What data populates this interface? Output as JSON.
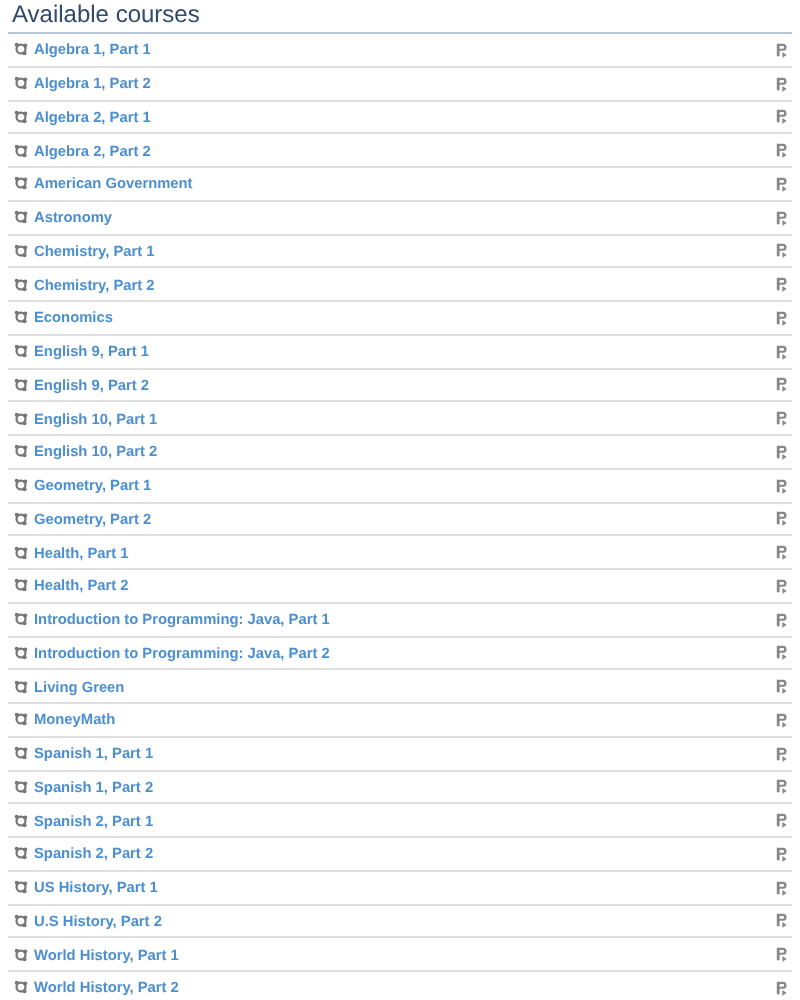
{
  "title": "Available courses",
  "courses": [
    {
      "name": "Algebra 1, Part 1"
    },
    {
      "name": "Algebra 1, Part 2"
    },
    {
      "name": "Algebra 2, Part 1"
    },
    {
      "name": "Algebra 2, Part 2"
    },
    {
      "name": "American Government"
    },
    {
      "name": "Astronomy"
    },
    {
      "name": "Chemistry, Part 1"
    },
    {
      "name": "Chemistry, Part 2"
    },
    {
      "name": "Economics"
    },
    {
      "name": "English 9, Part 1"
    },
    {
      "name": "English 9, Part 2"
    },
    {
      "name": "English 10, Part 1"
    },
    {
      "name": "English 10, Part 2"
    },
    {
      "name": "Geometry, Part 1"
    },
    {
      "name": "Geometry, Part 2"
    },
    {
      "name": "Health, Part 1"
    },
    {
      "name": "Health, Part 2"
    },
    {
      "name": "Introduction to Programming: Java, Part 1"
    },
    {
      "name": "Introduction to Programming: Java, Part 2"
    },
    {
      "name": "Living Green"
    },
    {
      "name": "MoneyMath"
    },
    {
      "name": "Spanish 1, Part 1"
    },
    {
      "name": "Spanish 1, Part 2"
    },
    {
      "name": "Spanish 2, Part 1"
    },
    {
      "name": "Spanish 2, Part 2"
    },
    {
      "name": "US History, Part 1"
    },
    {
      "name": "U.S History, Part 2"
    },
    {
      "name": "World History, Part 1"
    },
    {
      "name": "World History, Part 2"
    }
  ]
}
